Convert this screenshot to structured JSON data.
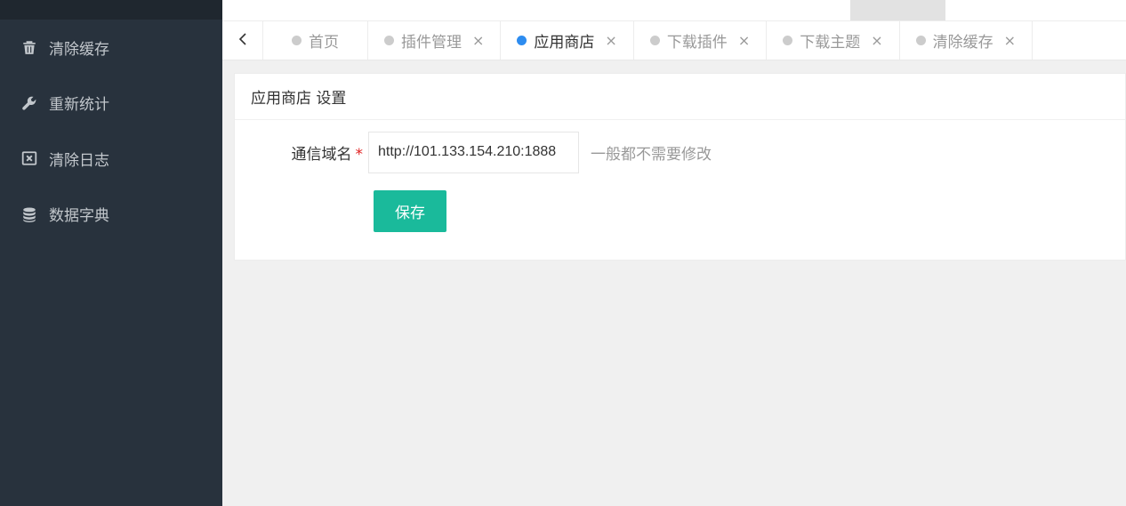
{
  "sidebar": {
    "items": [
      {
        "label": "清除缓存",
        "icon": "trash-icon"
      },
      {
        "label": "重新统计",
        "icon": "wrench-icon"
      },
      {
        "label": "清除日志",
        "icon": "close-box-icon"
      },
      {
        "label": "数据字典",
        "icon": "database-icon"
      }
    ]
  },
  "tabs": {
    "items": [
      {
        "label": "首页",
        "closable": false,
        "active": false
      },
      {
        "label": "插件管理",
        "closable": true,
        "active": false
      },
      {
        "label": "应用商店",
        "closable": true,
        "active": true
      },
      {
        "label": "下载插件",
        "closable": true,
        "active": false
      },
      {
        "label": "下载主题",
        "closable": true,
        "active": false
      },
      {
        "label": "清除缓存",
        "closable": true,
        "active": false
      }
    ],
    "close_glyph": "×"
  },
  "card": {
    "title": "应用商店 设置",
    "field": {
      "label": "通信域名",
      "required_mark": "*",
      "value": "http://101.133.154.210:1888",
      "hint": "一般都不需要修改"
    },
    "save_label": "保存"
  },
  "colors": {
    "sidebar_bg": "#28323d",
    "accent": "#1aba9b",
    "active_dot": "#2d8cf0"
  }
}
